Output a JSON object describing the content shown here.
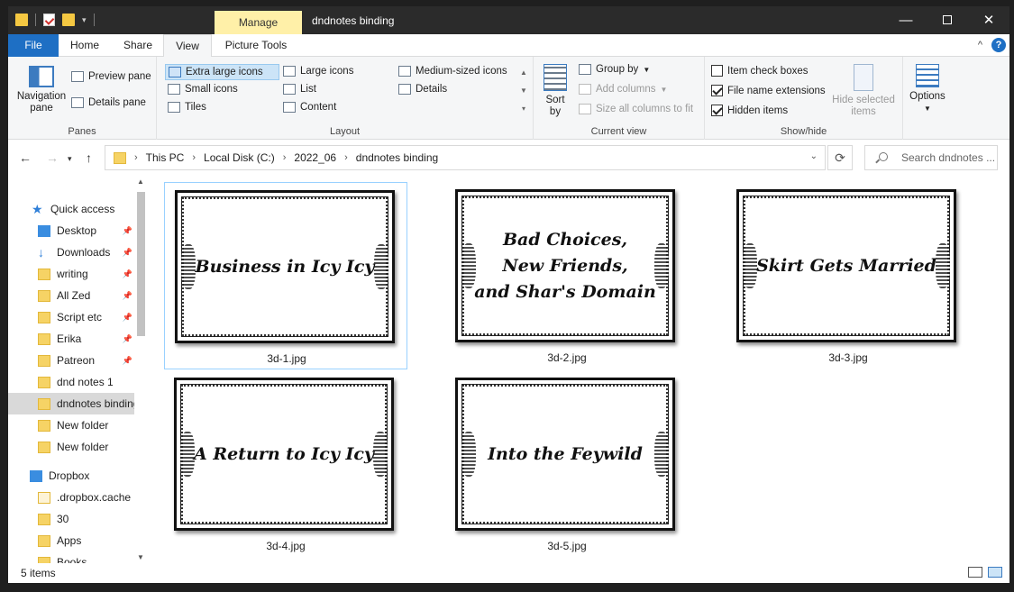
{
  "window": {
    "title": "dndnotes binding",
    "contextual_tab": "Manage",
    "controls": {
      "minimize": "—",
      "maximize": "",
      "close": "✕"
    }
  },
  "tabs": {
    "file": "File",
    "home": "Home",
    "share": "Share",
    "view": "View",
    "picture_tools": "Picture Tools",
    "help": "?",
    "collapse": "^"
  },
  "ribbon": {
    "panes": {
      "label": "Panes",
      "navigation_pane": "Navigation pane",
      "preview_pane": "Preview pane",
      "details_pane": "Details pane"
    },
    "layout": {
      "label": "Layout",
      "extra_large_icons": "Extra large icons",
      "large_icons": "Large icons",
      "medium_icons": "Medium-sized icons",
      "small_icons": "Small icons",
      "list": "List",
      "details": "Details",
      "tiles": "Tiles",
      "content": "Content"
    },
    "current_view": {
      "label": "Current view",
      "sort_by": "Sort by",
      "group_by": "Group by",
      "add_columns": "Add columns",
      "size_all_columns": "Size all columns to fit"
    },
    "show_hide": {
      "label": "Show/hide",
      "item_check_boxes": "Item check boxes",
      "file_name_extensions": "File name extensions",
      "hidden_items": "Hidden items",
      "hide_selected_items": "Hide selected items",
      "item_check_boxes_checked": false,
      "file_name_extensions_checked": true,
      "hidden_items_checked": true
    },
    "options": "Options"
  },
  "address": {
    "crumbs": [
      "This PC",
      "Local Disk (C:)",
      "2022_06",
      "dndnotes binding"
    ],
    "search_placeholder": "Search dndnotes ..."
  },
  "nav": {
    "quick_access": "Quick access",
    "items": [
      {
        "label": "Desktop",
        "pinned": true
      },
      {
        "label": "Downloads",
        "pinned": true
      },
      {
        "label": "writing",
        "pinned": true
      },
      {
        "label": "All Zed",
        "pinned": true
      },
      {
        "label": "Script etc",
        "pinned": true
      },
      {
        "label": "Erika",
        "pinned": true
      },
      {
        "label": "Patreon",
        "pinned": true
      },
      {
        "label": "dnd notes 1",
        "pinned": false
      },
      {
        "label": "dndnotes binding",
        "pinned": false
      },
      {
        "label": "New folder",
        "pinned": false
      },
      {
        "label": "New folder",
        "pinned": false
      }
    ],
    "dropbox": "Dropbox",
    "dropbox_items": [
      ".dropbox.cache",
      "30",
      "Apps",
      "Books"
    ]
  },
  "files": [
    {
      "name": "3d-1.jpg",
      "title": "Business in Icy Icy"
    },
    {
      "name": "3d-2.jpg",
      "title": "Bad Choices,\nNew Friends,\nand Shar's Domain"
    },
    {
      "name": "3d-3.jpg",
      "title": "Skirt Gets Married"
    },
    {
      "name": "3d-4.jpg",
      "title": "A Return to Icy Icy"
    },
    {
      "name": "3d-5.jpg",
      "title": "Into the Feywild"
    }
  ],
  "status": {
    "count": "5 items"
  },
  "colors": {
    "accent": "#1e6fc4",
    "manage_tab": "#fff0a8",
    "titlebar": "#2b2b2b"
  }
}
